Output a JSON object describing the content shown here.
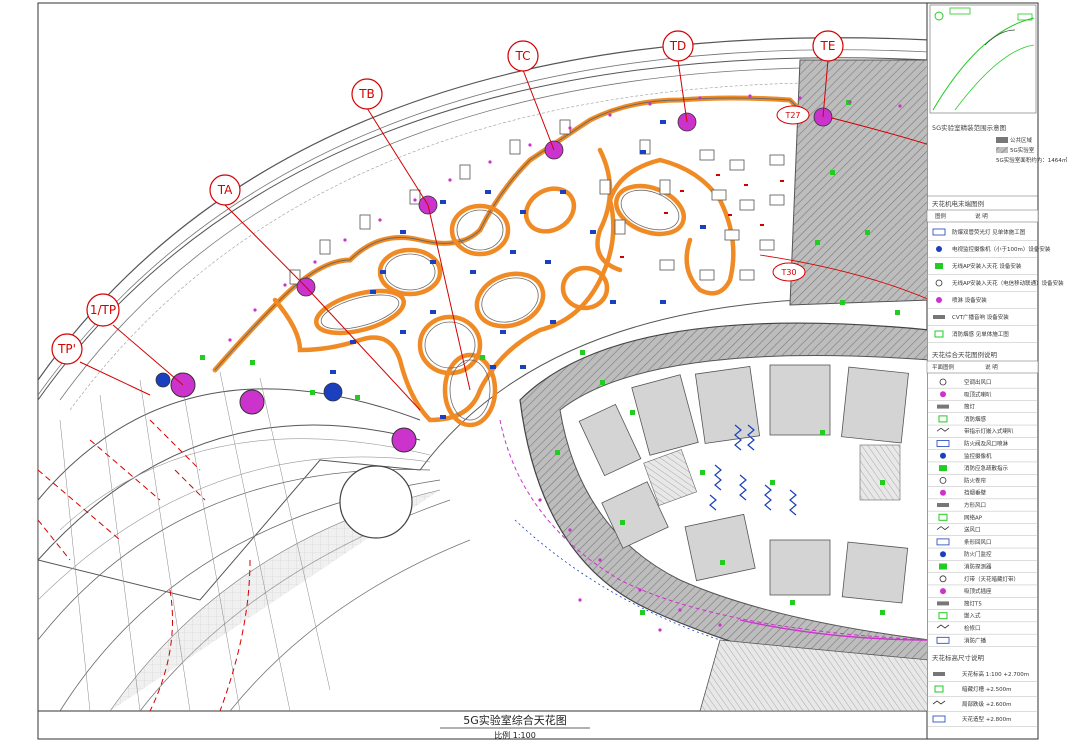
{
  "drawing": {
    "title": "5G实验室综合天花图",
    "scale": "比例 1:100"
  },
  "grid_markers": [
    {
      "id": "TA",
      "label": "TA"
    },
    {
      "id": "TB",
      "label": "TB"
    },
    {
      "id": "TC",
      "label": "TC"
    },
    {
      "id": "TD",
      "label": "TD"
    },
    {
      "id": "TE",
      "label": "TE"
    },
    {
      "id": "1TP",
      "label": "1/TP"
    },
    {
      "id": "TP1",
      "label": "TP'"
    }
  ],
  "column_tags": {
    "t27": "T27",
    "t30": "T30"
  },
  "key_plan": {
    "title": "5G实验室精装范围示意图",
    "items": [
      "公共区域",
      "5G实验室"
    ],
    "note": "5G实验室面积约为：1464㎡"
  },
  "legend": {
    "section1_title": "天花机电末端图例",
    "section1_header": [
      "图例",
      "说 明"
    ],
    "section1_items": [
      "防爆双管荧光灯 见单体施工图",
      "电视监控摄像机（小于100m）设备安装",
      "无线AP安装入天花 设备安装",
      "无线AP安装入天花（电信移动联通）设备安装",
      "喷淋 设备安装",
      "CVT广播音响 设备安装",
      "消防烟感 见单体施工图"
    ],
    "section2_title": "天花综合天花图例说明",
    "section2_header": [
      "平面图例",
      "说 明"
    ],
    "section2_items": [
      "空调出风口",
      "吸顶式喇叭",
      "筒灯",
      "消防烟感",
      "带指示灯嵌入式喇叭",
      "防火阀及风口喷淋",
      "监控摄像机",
      "消防应急疏散指示",
      "防火卷帘",
      "挡烟垂壁",
      "方形风口",
      "网络AP",
      "送风口",
      "条形回风口",
      "防火门监控",
      "消防探测器",
      "灯带（天花暗藏灯带）",
      "吸顶式插座",
      "筒灯T5",
      "嵌入式",
      "检修口",
      "消防广播"
    ],
    "section3_title": "天花标高尺寸说明",
    "section3_items": [
      "天花标高 1:100 +2.700m",
      "暗藏灯槽 +2.500m",
      "局部跌级 +2.600m",
      "天花造型 +2.800m"
    ]
  },
  "colors": {
    "orange_band": "#f08a24",
    "magenta": "#cc33cc",
    "marker_red": "#d40000",
    "equipment_blue": "#1a3fbf",
    "equipment_green": "#22cc22",
    "hatch_gray": "#9a9a9a",
    "dark_gray": "#555555"
  }
}
